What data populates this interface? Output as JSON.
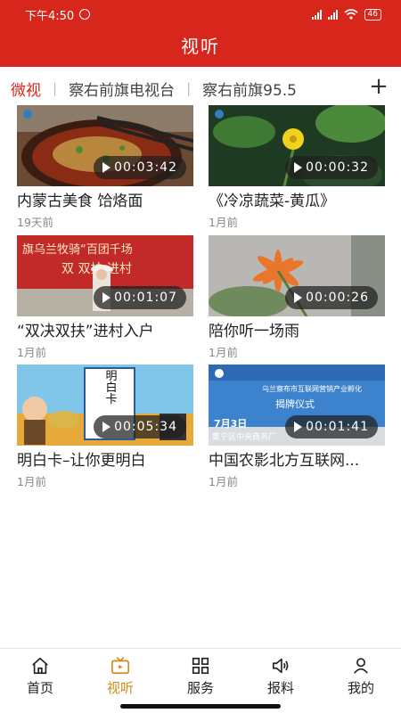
{
  "status_bar": {
    "time": "下午4:50",
    "signal1": "HD",
    "battery": "46"
  },
  "header": {
    "title": "视听"
  },
  "tabs": [
    {
      "label": "微视",
      "active": true
    },
    {
      "label": "察右前旗电视台",
      "active": false
    },
    {
      "label": "察右前旗95.5",
      "active": false
    }
  ],
  "add_channel_icon": "plus-icon",
  "videos": [
    {
      "title": "内蒙古美食  饸烙面",
      "time": "19天前",
      "duration": "00:03:42"
    },
    {
      "title": "《冷凉蔬菜-黄瓜》",
      "time": "1月前",
      "duration": "00:00:32"
    },
    {
      "title": "“双决双扶”进村入户",
      "time": "1月前",
      "duration": "00:01:07"
    },
    {
      "title": "陪你听一场雨",
      "time": "1月前",
      "duration": "00:00:26"
    },
    {
      "title": "明白卡–让你更明白",
      "time": "1月前",
      "duration": "00:05:34"
    },
    {
      "title": "中国农影北方互联网...",
      "time": "1月前",
      "duration": "00:01:41"
    }
  ],
  "thumb_text": {
    "banner_line": "旗乌兰牧骑“百团千场",
    "banner_line2": "双  双扶  进村",
    "card_text": "明白卡",
    "event_line1": "乌兰察布市互联网营销产业孵化",
    "event_line2": "揭牌仪式",
    "event_date": "7月3日",
    "event_place": "集宁区中央商务厂"
  },
  "nav": [
    {
      "label": "首页",
      "icon": "home-icon",
      "active": false
    },
    {
      "label": "视听",
      "icon": "tv-icon",
      "active": true
    },
    {
      "label": "服务",
      "icon": "grid-icon",
      "active": false
    },
    {
      "label": "报料",
      "icon": "megaphone-icon",
      "active": false
    },
    {
      "label": "我的",
      "icon": "user-icon",
      "active": false
    }
  ],
  "colors": {
    "brand": "#d7261c",
    "nav_active": "#d28a1c"
  }
}
